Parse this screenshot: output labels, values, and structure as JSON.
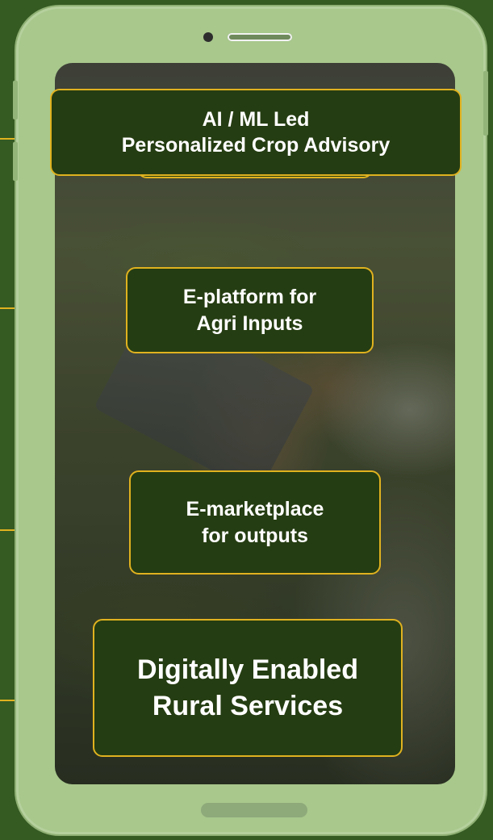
{
  "boxes": {
    "crop_advisory": "AI / ML Led\nPersonalized Crop Advisory",
    "agri_inputs": "E-platform for\nAgri Inputs",
    "marketplace": "E-marketplace\nfor outputs",
    "rural_services": "Digitally Enabled\nRural Services"
  },
  "colors": {
    "background": "#355a22",
    "phone_body": "#a8c88c",
    "box_fill": "#253d12",
    "box_border": "#e0b21f",
    "text": "#ffffff"
  }
}
